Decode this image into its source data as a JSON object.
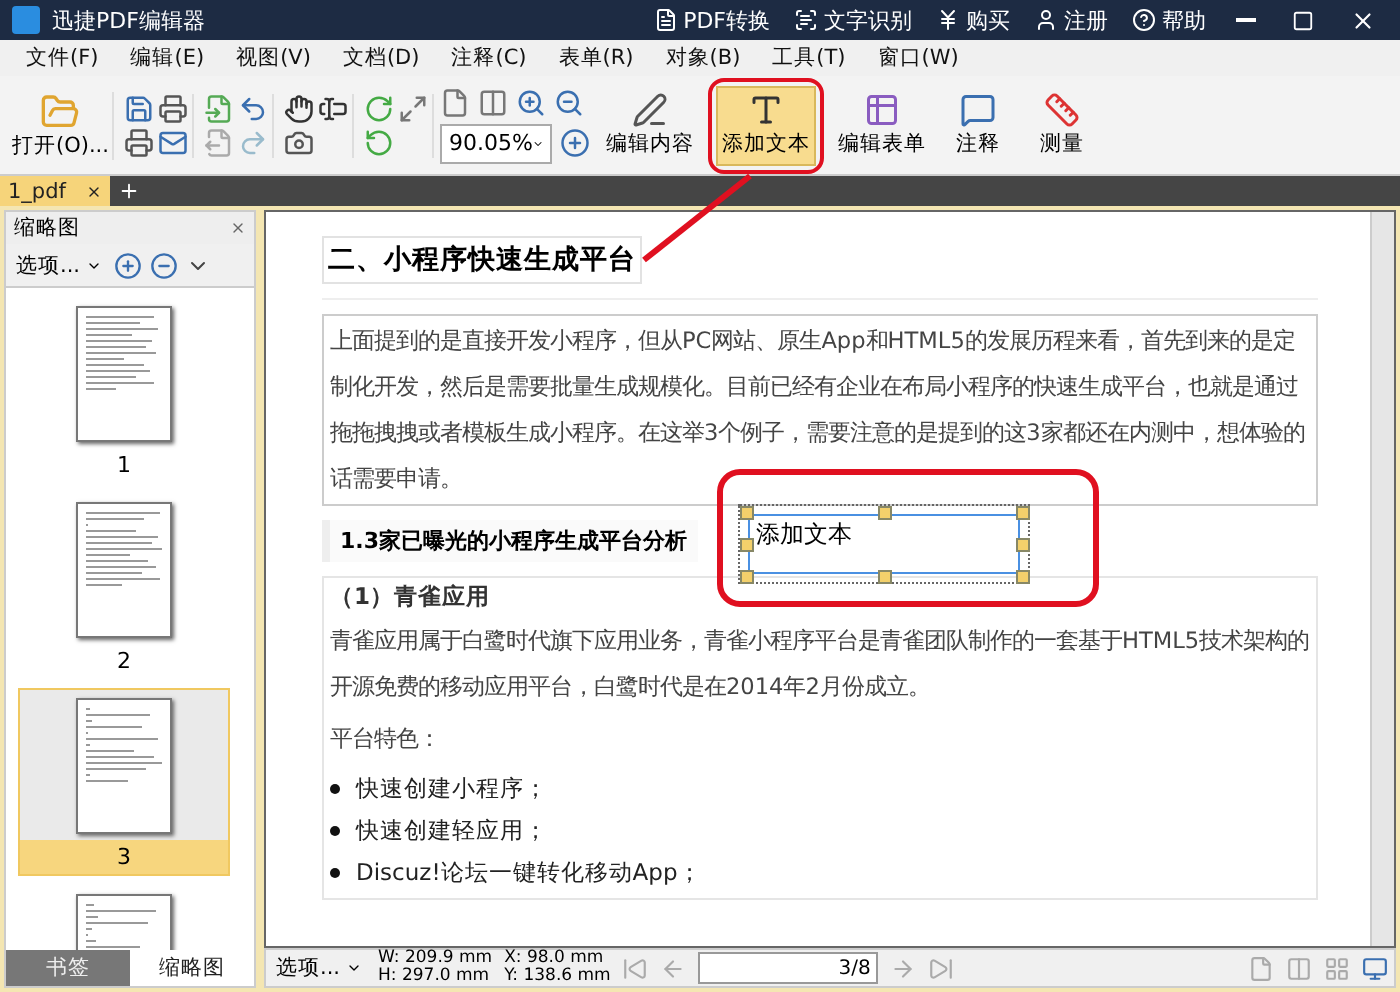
{
  "window": {
    "title": "迅捷PDF编辑器"
  },
  "title_actions": [
    {
      "label": "PDF转换"
    },
    {
      "label": "文字识别"
    },
    {
      "label": "购买"
    },
    {
      "label": "注册"
    },
    {
      "label": "帮助"
    }
  ],
  "menu": [
    "文件(F)",
    "编辑(E)",
    "视图(V)",
    "文档(D)",
    "注释(C)",
    "表单(R)",
    "对象(B)",
    "工具(T)",
    "窗口(W)"
  ],
  "toolbar": {
    "open_label": "打开(O)...",
    "zoom": "90.05%",
    "big_buttons": [
      {
        "label": "编辑内容",
        "selected": false,
        "kind": "edit"
      },
      {
        "label": "添加文本",
        "selected": true,
        "kind": "text"
      },
      {
        "label": "编辑表单",
        "selected": false,
        "kind": "form"
      },
      {
        "label": "注释",
        "selected": false,
        "kind": "comment"
      },
      {
        "label": "测量",
        "selected": false,
        "kind": "measure"
      }
    ]
  },
  "tabs": [
    {
      "label": "1_pdf",
      "selected": true
    }
  ],
  "thumbnail_panel": {
    "title": "缩略图",
    "options": "选项...",
    "thumbnails": [
      {
        "label": "1",
        "selected": false
      },
      {
        "label": "2",
        "selected": false
      },
      {
        "label": "3",
        "selected": true
      },
      {
        "selected": false
      }
    ],
    "bottom_tabs": [
      {
        "label": "书签",
        "selected": false
      },
      {
        "label": "缩略图",
        "selected": true
      }
    ]
  },
  "document": {
    "heading": "二、小程序快速生成平台",
    "paragraph": "上面提到的是直接开发小程序，但从PC网站、原生App和HTML5的发展历程来看，首先到来的是定制化开发，然后是需要批量生成规模化。目前已经有企业在布局小程序的快速生成平台，也就是通过拖拖拽拽或者模板生成小程序。在这举3个例子，需要注意的是提到的这3家都还在内测中，想体验的话需要申请。",
    "subheading": "1.3家已曝光的小程序生成平台分析",
    "text_box": "添加文本",
    "section_title": "（1）青雀应用",
    "section_paragraph": "青雀应用属于白鹭时代旗下应用业务，青雀小程序平台是青雀团队制作的一套基于HTML5技术架构的开源免费的移动应用平台，白鹭时代是在2014年2月份成立。",
    "features_label": "平台特色：",
    "bullets": [
      "快速创建小程序；",
      "快速创建轻应用；",
      "Discuz!论坛一键转化移动App；"
    ]
  },
  "status_bar": {
    "options": "选项...",
    "width": "W: 209.9 mm",
    "height": "H: 297.0 mm",
    "x": "X:   98.0 mm",
    "y": "Y: 138.6 mm",
    "page": "3",
    "page_total": "/8"
  }
}
